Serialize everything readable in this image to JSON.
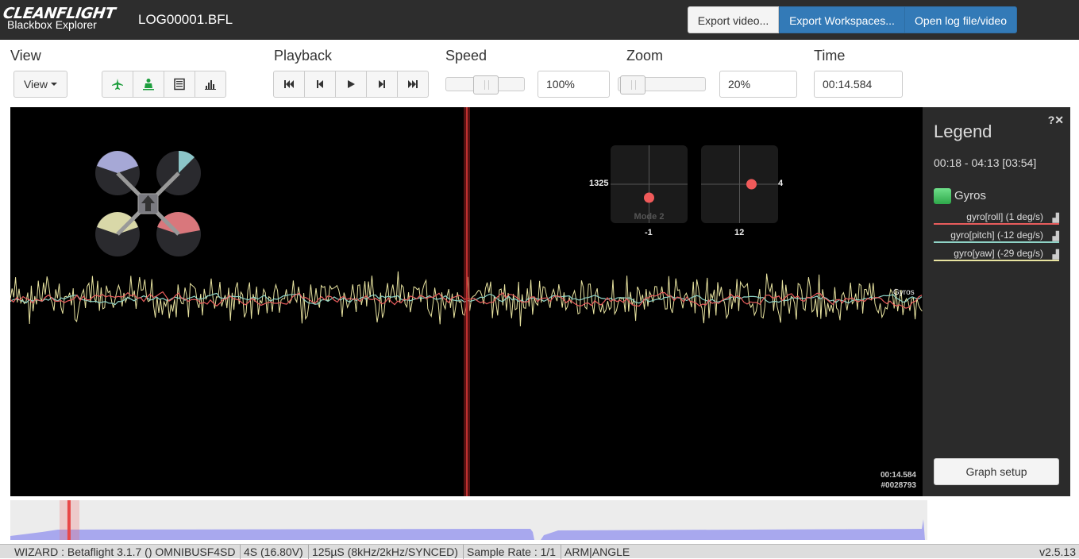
{
  "navbar": {
    "logo": "CLEANFLIGHT",
    "subtitle": "Blackbox Explorer",
    "log_name": "LOG00001.BFL",
    "export_video": "Export video...",
    "export_workspaces": "Export Workspaces...",
    "open_log": "Open log file/video"
  },
  "toolbar": {
    "view_title": "View",
    "view_dropdown": "View",
    "view_icons": [
      "airplane-icon",
      "pilot-icon",
      "table-icon",
      "analyser-icon"
    ],
    "playback_title": "Playback",
    "playback_icons": [
      "skip-start-icon",
      "step-back-icon",
      "play-icon",
      "step-forward-icon",
      "skip-end-icon"
    ],
    "speed_title": "Speed",
    "speed_value": "100%",
    "speed_level": 0.5,
    "zoom_title": "Zoom",
    "zoom_value": "20%",
    "zoom_level": 0.02,
    "time_title": "Time",
    "time_value": "00:14.584"
  },
  "graph": {
    "stick_left": {
      "top_label": "1325",
      "bottom_label": "-1",
      "mode": "Mode 2",
      "x": 0.0,
      "y": -0.25
    },
    "stick_right": {
      "side_label": "4",
      "bottom_label": "12",
      "x": 0.2,
      "y": 0.0
    },
    "time": "00:14.584",
    "frame": "#0028793",
    "series_label": "Gyros",
    "colors": {
      "roll": "#e85c5c",
      "pitch": "#8fd3c6",
      "yaw": "#e8e3a0",
      "cursor": "#c03030"
    }
  },
  "legend": {
    "title": "Legend",
    "range": "00:18 - 04:13 [03:54]",
    "group": "Gyros",
    "fields": [
      {
        "label": "gyro[roll] (1 deg/s)",
        "color": "#e85c5c"
      },
      {
        "label": "gyro[pitch] (-12 deg/s)",
        "color": "#8fd3c6"
      },
      {
        "label": "gyro[yaw] (-29 deg/s)",
        "color": "#e8e3a0"
      }
    ],
    "graph_setup": "Graph setup"
  },
  "seek": {
    "position": 0.064
  },
  "status": {
    "items": [
      "WIZARD : Betaflight 3.1.7 () OMNIBUSF4SD",
      "4S (16.80V)",
      "125µS (8kHz/2kHz/SYNCED)",
      "Sample Rate : 1/1",
      "ARM|ANGLE"
    ],
    "version": "v2.5.13"
  }
}
